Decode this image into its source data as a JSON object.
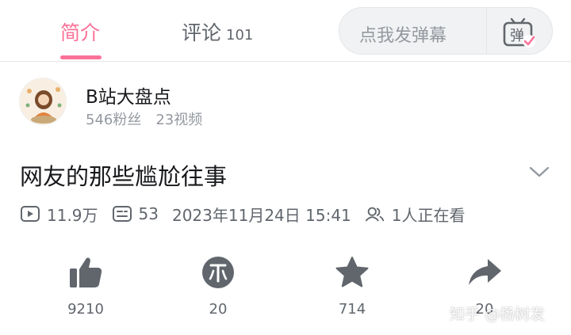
{
  "tabs": {
    "intro_label": "简介",
    "comments_label": "评论",
    "comments_count": "101"
  },
  "danmaku": {
    "placeholder": "点我发弹幕",
    "toggle_icon": "danmaku-toggle-icon",
    "toggle_glyph": "弹"
  },
  "uploader": {
    "name": "B站大盘点",
    "followers": "546粉丝",
    "videos": "23视频"
  },
  "video": {
    "title": "网友的那些尴尬往事",
    "plays": "11.9万",
    "danmaku_count": "53",
    "published": "2023年11月24日 15:41",
    "watching": "1人正在看"
  },
  "actions": {
    "like_count": "9210",
    "coin_count": "20",
    "favorite_count": "714",
    "share_count": "20"
  },
  "watermark": "知乎 @杨树发",
  "colors": {
    "accent": "#fb7299",
    "text_primary": "#18191c",
    "text_secondary": "#61666d",
    "text_muted": "#9499a0",
    "icon_dark": "#61666d"
  }
}
